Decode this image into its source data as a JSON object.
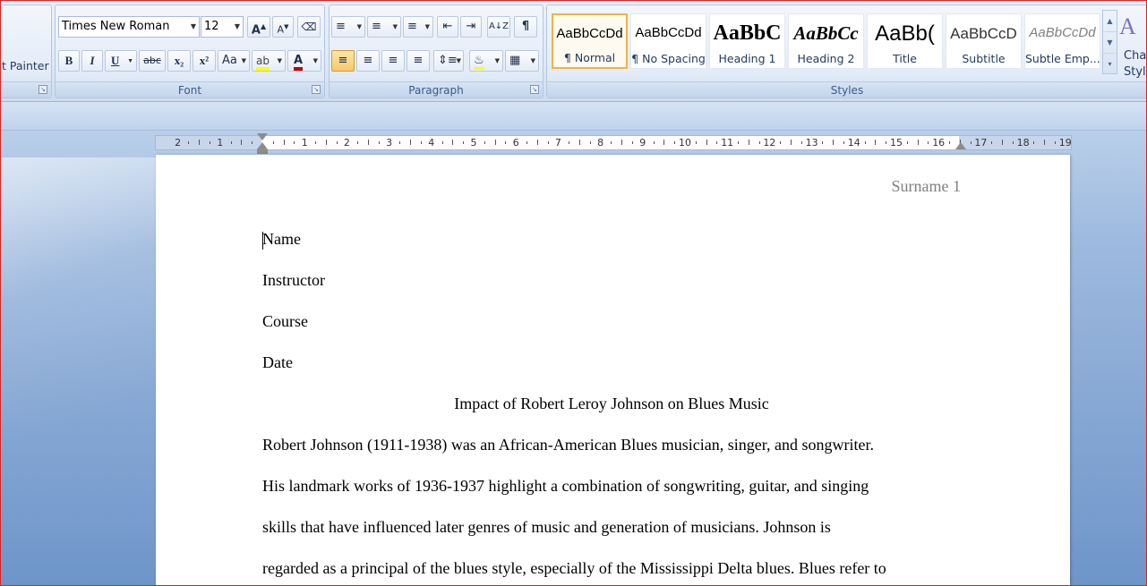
{
  "ribbon": {
    "clipboard": {
      "format_painter_label": "t Painter"
    },
    "font": {
      "group_label": "Font",
      "font_name": "Times New Roman",
      "font_size": "12",
      "grow_font": "A",
      "shrink_font": "A",
      "bold": "B",
      "italic": "I",
      "underline": "U",
      "strikethrough": "abc",
      "subscript": "x₂",
      "superscript": "x²",
      "change_case": "Aa",
      "highlight_color": "#ffff00",
      "font_color": "#c00000",
      "font_color_glyph": "A"
    },
    "paragraph": {
      "group_label": "Paragraph",
      "show_marks": "¶"
    },
    "styles": {
      "group_label": "Styles",
      "items": [
        {
          "sample": "AaBbCcDd",
          "name": "¶ Normal",
          "selected": true
        },
        {
          "sample": "AaBbCcDd",
          "name": "¶ No Spacing",
          "selected": false
        },
        {
          "sample": "AaBbC",
          "name": "Heading 1",
          "selected": false
        },
        {
          "sample": "AaBbCc",
          "name": "Heading 2",
          "selected": false
        },
        {
          "sample": "AaBb(",
          "name": "Title",
          "selected": false
        },
        {
          "sample": "AaBbCcD",
          "name": "Subtitle",
          "selected": false
        },
        {
          "sample": "AaBbCcDd",
          "name": "Subtle Emp...",
          "selected": false
        }
      ],
      "change_styles_label_1": "Chan",
      "change_styles_label_2": "Style"
    }
  },
  "ruler": {
    "left_numbers": [
      "2",
      "1"
    ],
    "right_numbers": [
      "1",
      "2",
      "3",
      "4",
      "5",
      "6",
      "7",
      "8",
      "9",
      "10",
      "11",
      "12",
      "13",
      "14",
      "15",
      "16",
      "17",
      "18",
      "19"
    ]
  },
  "document": {
    "header": "Surname 1",
    "lines": [
      "Name",
      "Instructor",
      "Course",
      "Date"
    ],
    "title": "Impact of Robert Leroy Johnson on Blues Music",
    "body": [
      "Robert Johnson (1911-1938) was an African-American Blues musician, singer, and songwriter.",
      "His landmark works of 1936-1937 highlight a combination of songwriting, guitar, and singing",
      "skills that have influenced later genres of music and generation of musicians. Johnson is",
      "regarded as a principal of the blues style, especially of the Mississippi Delta blues. Blues refer to"
    ]
  },
  "colors": {
    "accent_frame": "#e0201e",
    "ribbon_label": "#3b5a89",
    "header_text": "#808080"
  }
}
